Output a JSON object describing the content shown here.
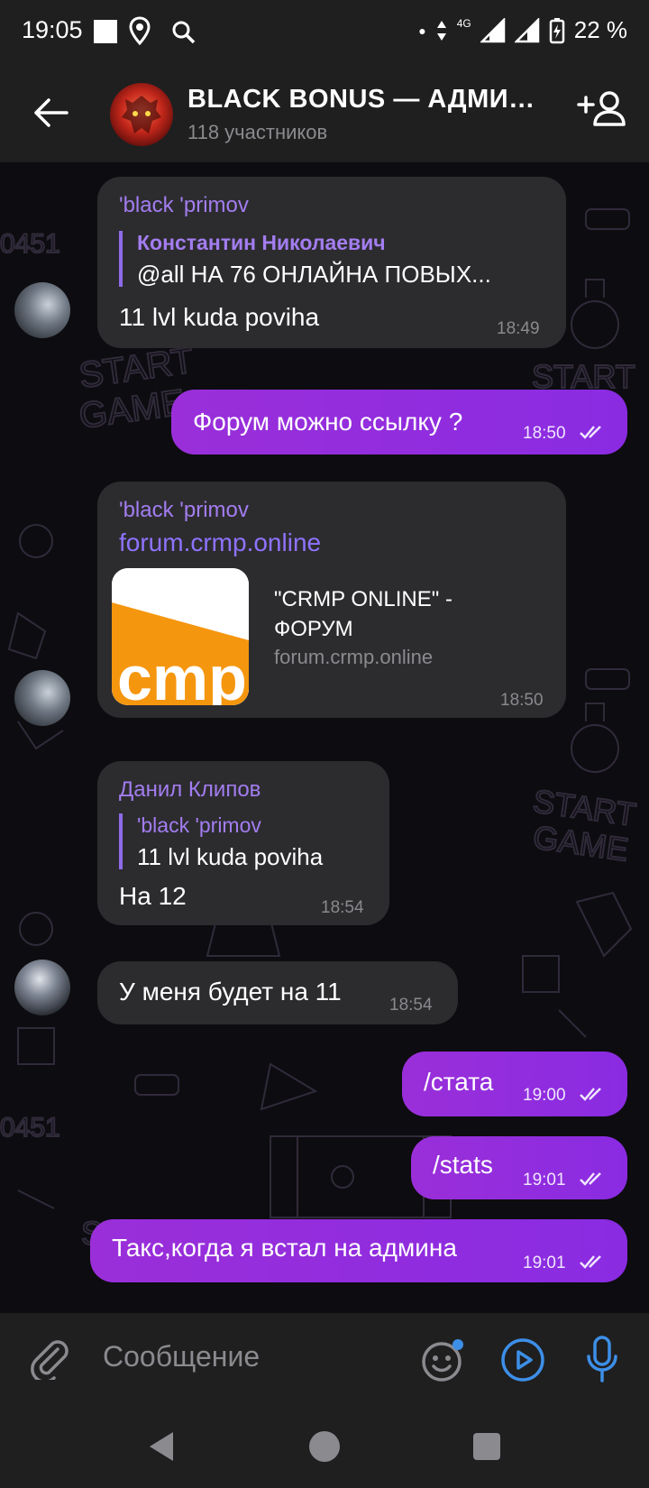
{
  "status_bar": {
    "time": "19:05",
    "network": "4G",
    "battery": "22 %"
  },
  "header": {
    "title": "BLACK BONUS — АДМИНИСТРАЦИЯ",
    "subtitle": "118 участников"
  },
  "messages": [
    {
      "sender": "'black 'primov",
      "reply_name": "Константин Николаевич",
      "reply_text": "@all НА 76 ОНЛАЙНА ПОВЫХ...",
      "text": "11 lvl kuda poviha",
      "time": "18:49"
    },
    {
      "text": "Форум можно ссылку ?",
      "time": "18:50"
    },
    {
      "sender": "'black 'primov",
      "link": "forum.crmp.online",
      "preview_title_1": "\"CRMP ONLINE\" -",
      "preview_title_2": "ФОРУМ",
      "preview_site": "forum.crmp.online",
      "preview_logo": "cmp",
      "time": "18:50"
    },
    {
      "sender": "Данил Клипов",
      "reply_name": "'black 'primov",
      "reply_text": "11 lvl kuda poviha",
      "text": "На 12",
      "time": "18:54"
    },
    {
      "text": "У меня будет на 11",
      "time": "18:54"
    },
    {
      "text": "/стата",
      "time": "19:00"
    },
    {
      "text": "/stats",
      "time": "19:01"
    },
    {
      "text": "Такс,когда я встал на админа",
      "time": "19:01"
    }
  ],
  "input": {
    "placeholder": "Сообщение"
  },
  "colors": {
    "accent": "#a37df0",
    "outgoing": "#8a2be2",
    "incoming": "#2c2c2f",
    "icon_blue": "#3d8fe8"
  },
  "icons": [
    "back-arrow-icon",
    "add-member-icon",
    "attach-icon",
    "emoji-icon",
    "video-note-icon",
    "microphone-icon"
  ]
}
